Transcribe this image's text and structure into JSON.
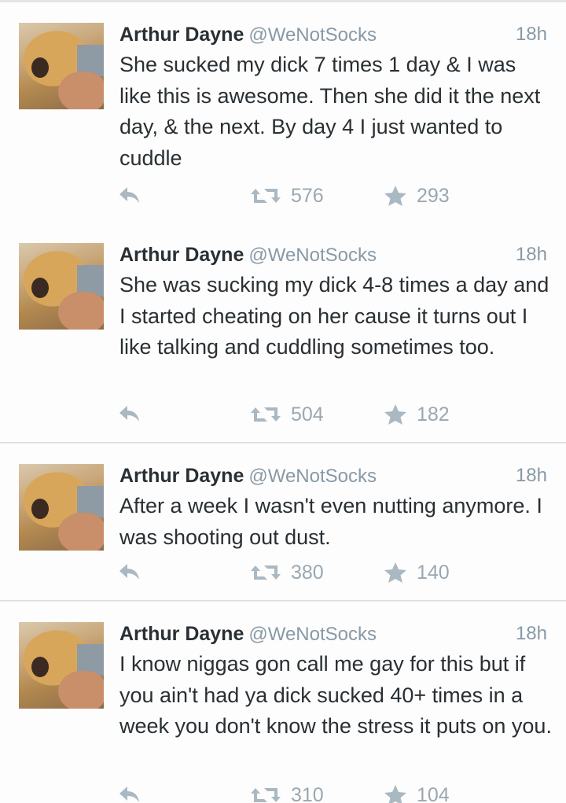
{
  "tweets": [
    {
      "name": "Arthur Dayne",
      "handle": "@WeNotSocks",
      "time": "18h",
      "text": "She sucked my dick 7 times 1 day & I was like this is awesome. Then she did it the next day, & the next. By day 4 I just wanted to cuddle",
      "retweets": "576",
      "favorites": "293"
    },
    {
      "name": "Arthur Dayne",
      "handle": "@WeNotSocks",
      "time": "18h",
      "text": "She was sucking my dick 4-8 times a day and I started cheating on her cause it turns out I like talking and cuddling sometimes too.",
      "retweets": "504",
      "favorites": "182"
    },
    {
      "name": "Arthur Dayne",
      "handle": "@WeNotSocks",
      "time": "18h",
      "text": "After a week I wasn't even nutting anymore. I was shooting out dust.",
      "retweets": "380",
      "favorites": "140"
    },
    {
      "name": "Arthur Dayne",
      "handle": "@WeNotSocks",
      "time": "18h",
      "text": "I know niggas gon call me gay for this but if you ain't had ya dick sucked 40+ times in a week you don't know the stress it puts on you.",
      "retweets": "310",
      "favorites": "104"
    }
  ],
  "icons": {
    "reply": "reply-icon",
    "retweet": "retweet-icon",
    "favorite": "star-icon"
  },
  "colors": {
    "icon_gray": "#aab8c2",
    "meta_gray": "#8899a6",
    "text": "#292f33"
  }
}
